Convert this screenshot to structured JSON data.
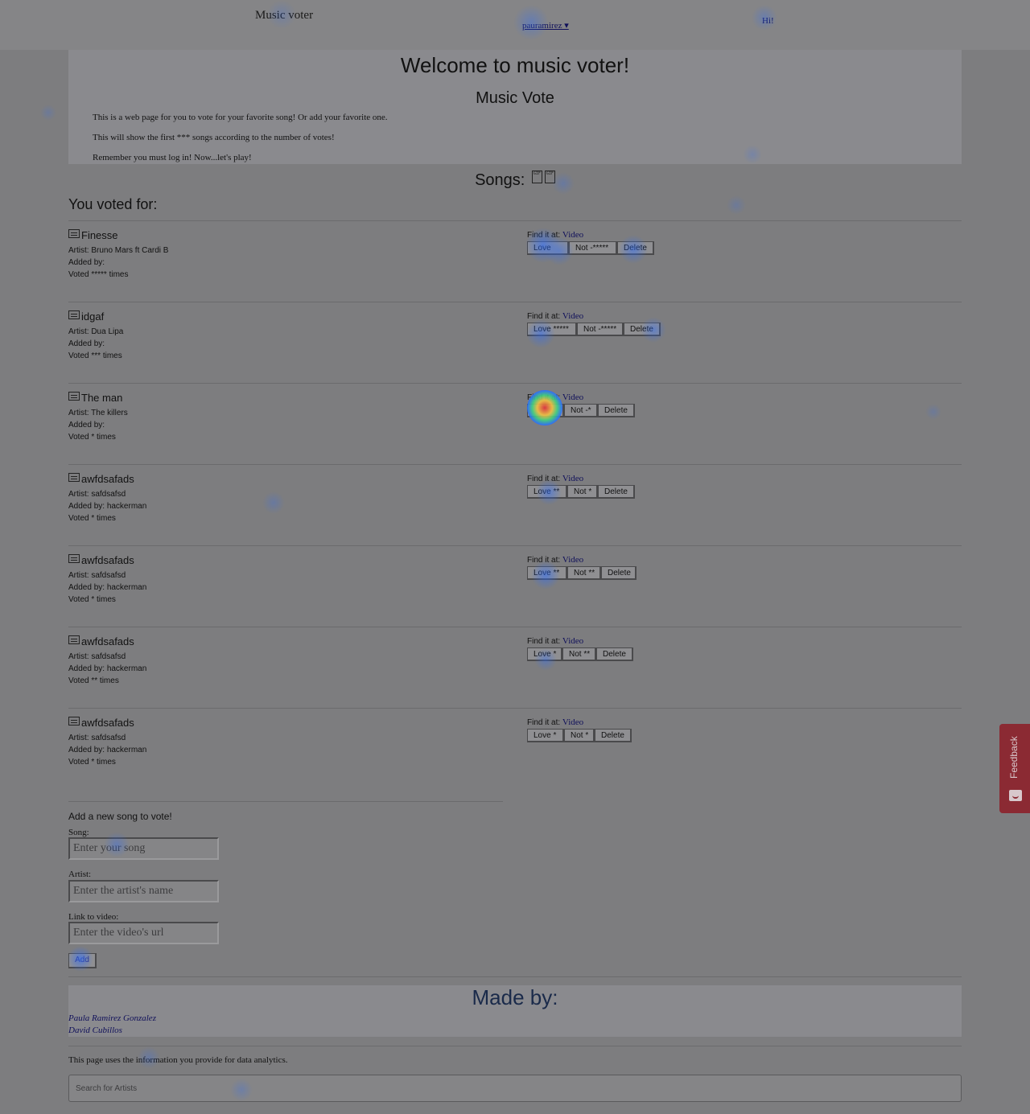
{
  "header": {
    "brand": "Music voter",
    "user_menu": "pauramirez ▾",
    "greeting": "Hi!"
  },
  "hero": {
    "title": "Welcome to music voter!",
    "subtitle": "Music Vote",
    "paragraphs": [
      "This is a web page for you to vote for your favorite song! Or add your favorite one.",
      "This will show the first *** songs according to the number of votes!",
      "Remember you must log in! Now...let's play!"
    ]
  },
  "songs_heading": "Songs:",
  "gif_badges": [
    "GIF",
    "GIF"
  ],
  "voted_for": "You voted for:",
  "songs": [
    {
      "title": "Finesse",
      "artist": "Artist: Bruno Mars ft Cardi B",
      "added_by": "Added by:",
      "votes": "Voted ***** times",
      "find_label": "Find it at:",
      "video": "Video",
      "love": "Love ",
      "not": "Not -*****",
      "delete": "Delete"
    },
    {
      "title": "idgaf",
      "artist": "Artist: Dua Lipa",
      "added_by": "Added by:",
      "votes": "Voted *** times",
      "find_label": "Find it at:",
      "video": "Video",
      "love": "Love *****",
      "not": "Not -*****",
      "delete": "Delete"
    },
    {
      "title": "The man",
      "artist": "Artist: The killers",
      "added_by": "Added by:",
      "votes": "Voted * times",
      "find_label": "Find it at:",
      "video": "Video",
      "love": "",
      "not": "Not -*",
      "delete": "Delete"
    },
    {
      "title": "awfdsafads",
      "artist": "Artist: safdsafsd",
      "added_by": "Added by: hackerman",
      "votes": "Voted * times",
      "find_label": "Find it at:",
      "video": "Video",
      "love": "Love **",
      "not": "Not *",
      "delete": "Delete"
    },
    {
      "title": "awfdsafads",
      "artist": "Artist: safdsafsd",
      "added_by": "Added by: hackerman",
      "votes": "Voted * times",
      "find_label": "Find it at:",
      "video": "Video",
      "love": "Love **",
      "not": "Not **",
      "delete": "Delete"
    },
    {
      "title": "awfdsafads",
      "artist": "Artist: safdsafsd",
      "added_by": "Added by: hackerman",
      "votes": "Voted ** times",
      "find_label": "Find it at:",
      "video": "Video",
      "love": "Love *",
      "not": "Not **",
      "delete": "Delete"
    },
    {
      "title": "awfdsafads",
      "artist": "Artist: safdsafsd",
      "added_by": "Added by: hackerman",
      "votes": "Voted * times",
      "find_label": "Find it at:",
      "video": "Video",
      "love": "Love *",
      "not": "Not *",
      "delete": "Delete"
    }
  ],
  "add_form": {
    "title": "Add a new song to vote!",
    "song_label": "Song:",
    "song_placeholder": "Enter your song",
    "artist_label": "Artist:",
    "artist_placeholder": "Enter the artist's name",
    "link_label": "Link to video:",
    "link_placeholder": "Enter the video's url",
    "add_label": "Add"
  },
  "footer": {
    "made_by": "Made by:",
    "authors": [
      "Paula Ramirez Gonzalez",
      "David Cubillos"
    ],
    "analytics_notice": "This page uses the information you provide for data analytics.",
    "search_placeholder": "Search for Artists"
  },
  "feedback_tab": {
    "label": "Feedback",
    "icon": "chat-icon"
  },
  "colors": {
    "page_overlay": "#7d7d7f",
    "link": "#10105a",
    "feedback": "#8b2a33",
    "heat_blue": "#2a6cff",
    "heat_hot": "#e0303a"
  }
}
